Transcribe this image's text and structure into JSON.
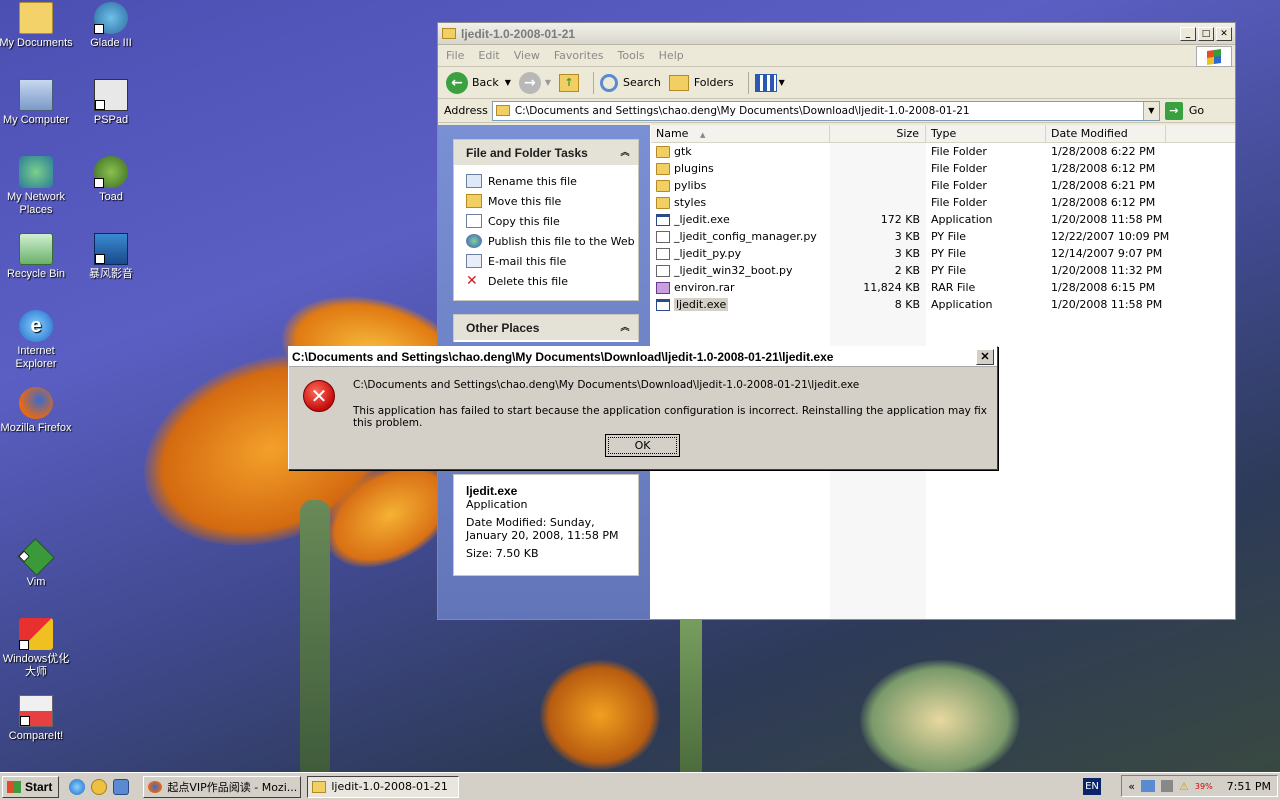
{
  "desktop": {
    "icons": [
      {
        "label": "My Documents"
      },
      {
        "label": "Glade III"
      },
      {
        "label": "My Computer"
      },
      {
        "label": "PSPad"
      },
      {
        "label": "My Network Places"
      },
      {
        "label": "Toad"
      },
      {
        "label": "Recycle Bin"
      },
      {
        "label": "暴风影音"
      },
      {
        "label": "Internet Explorer"
      },
      {
        "label": "Mozilla Firefox"
      },
      {
        "label": "Vim"
      },
      {
        "label": "Windows优化大师"
      },
      {
        "label": "CompareIt!"
      }
    ]
  },
  "window": {
    "title": "ljedit-1.0-2008-01-21",
    "menu": [
      "File",
      "Edit",
      "View",
      "Favorites",
      "Tools",
      "Help"
    ],
    "toolbar": {
      "back": "Back",
      "search": "Search",
      "folders": "Folders"
    },
    "address": {
      "label": "Address",
      "value": "C:\\Documents and Settings\\chao.deng\\My Documents\\Download\\ljedit-1.0-2008-01-21",
      "go": "Go"
    },
    "tasks_panel": {
      "title": "File and Folder Tasks",
      "items": [
        "Rename this file",
        "Move this file",
        "Copy this file",
        "Publish this file to the Web",
        "E-mail this file",
        "Delete this file"
      ]
    },
    "other_places": {
      "title": "Other Places"
    },
    "details": {
      "name": "ljedit.exe",
      "type": "Application",
      "modified": "Date Modified: Sunday, January 20, 2008, 11:58 PM",
      "size": "Size: 7.50 KB"
    },
    "columns": {
      "name": "Name",
      "size": "Size",
      "type": "Type",
      "date": "Date Modified"
    },
    "files": [
      {
        "name": "gtk",
        "size": "",
        "type": "File Folder",
        "date": "1/28/2008 6:22 PM",
        "icon": "folder"
      },
      {
        "name": "plugins",
        "size": "",
        "type": "File Folder",
        "date": "1/28/2008 6:12 PM",
        "icon": "folder"
      },
      {
        "name": "pylibs",
        "size": "",
        "type": "File Folder",
        "date": "1/28/2008 6:21 PM",
        "icon": "folder"
      },
      {
        "name": "styles",
        "size": "",
        "type": "File Folder",
        "date": "1/28/2008 6:12 PM",
        "icon": "folder"
      },
      {
        "name": "_ljedit.exe",
        "size": "172 KB",
        "type": "Application",
        "date": "1/20/2008 11:58 PM",
        "icon": "app"
      },
      {
        "name": "_ljedit_config_manager.py",
        "size": "3 KB",
        "type": "PY File",
        "date": "12/22/2007 10:09 PM",
        "icon": "py"
      },
      {
        "name": "_ljedit_py.py",
        "size": "3 KB",
        "type": "PY File",
        "date": "12/14/2007 9:07 PM",
        "icon": "py"
      },
      {
        "name": "_ljedit_win32_boot.py",
        "size": "2 KB",
        "type": "PY File",
        "date": "1/20/2008 11:32 PM",
        "icon": "py"
      },
      {
        "name": "environ.rar",
        "size": "11,824 KB",
        "type": "RAR File",
        "date": "1/28/2008 6:15 PM",
        "icon": "rar"
      },
      {
        "name": "ljedit.exe",
        "size": "8 KB",
        "type": "Application",
        "date": "1/20/2008 11:58 PM",
        "icon": "app"
      }
    ]
  },
  "dialog": {
    "title": "C:\\Documents and Settings\\chao.deng\\My Documents\\Download\\ljedit-1.0-2008-01-21\\ljedit.exe",
    "path": "C:\\Documents and Settings\\chao.deng\\My Documents\\Download\\ljedit-1.0-2008-01-21\\ljedit.exe",
    "message": "This application has failed to start because the application configuration is incorrect. Reinstalling the application may fix this problem.",
    "ok": "OK",
    "close": "✕"
  },
  "taskbar": {
    "start": "Start",
    "tasks": [
      "起点VIP作品阅读 - Mozi...",
      "ljedit-1.0-2008-01-21"
    ],
    "lang": "EN",
    "battery": "39%",
    "clock": "7:51 PM"
  }
}
